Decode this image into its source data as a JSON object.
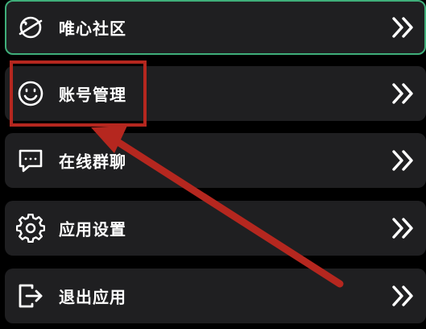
{
  "menu": {
    "items": [
      {
        "label": "唯心社区",
        "icon": "planet-icon"
      },
      {
        "label": "账号管理",
        "icon": "smiley-icon"
      },
      {
        "label": "在线群聊",
        "icon": "chat-bubble-icon"
      },
      {
        "label": "应用设置",
        "icon": "gear-icon"
      },
      {
        "label": "退出应用",
        "icon": "exit-icon"
      }
    ],
    "trailing_icon": "double-chevron-right-icon"
  },
  "annotation": {
    "color": "#b5271f",
    "highlighted_item": "账号管理"
  },
  "colors": {
    "background": "#000000",
    "item_background": "#1f1f21",
    "active_border": "#3fae7a",
    "text": "#ffffff"
  }
}
